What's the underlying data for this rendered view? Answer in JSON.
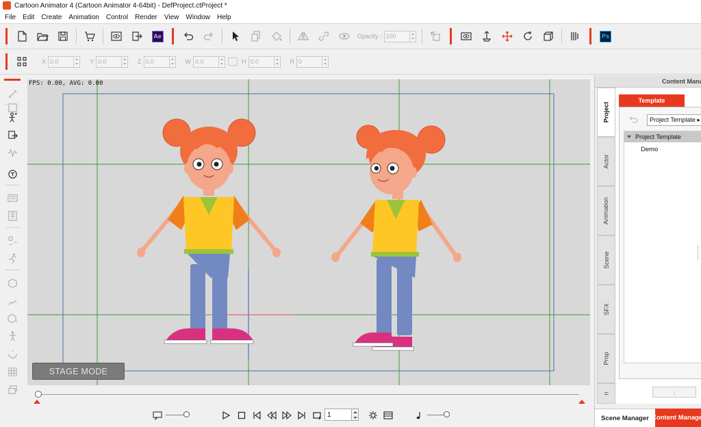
{
  "window": {
    "title": "Cartoon Animator 4  (Cartoon Animator 4-64bit) - DefProject.ctProject *"
  },
  "menu": [
    "File",
    "Edit",
    "Create",
    "Animation",
    "Control",
    "Render",
    "View",
    "Window",
    "Help"
  ],
  "toolbar": {
    "ae_label": "Ae",
    "ps_label": "Ps",
    "opacity_label": "Opacity :",
    "opacity_value": "100"
  },
  "transform": {
    "x_label": "X",
    "x_value": "0.0",
    "y_label": "Y",
    "y_value": "0.0",
    "z_label": "Z",
    "z_value": "0.0",
    "w_label": "W",
    "w_value": "0.0",
    "h_label": "H",
    "h_value": "0.0",
    "r_label": "R",
    "r_value": "0"
  },
  "stage": {
    "fps_text": "FPS: 0.00, AVG: 0.00",
    "mode_label": "STAGE MODE"
  },
  "playback": {
    "frame_value": "1"
  },
  "panel": {
    "header": "Content Manager",
    "vertical_tabs": [
      "Project",
      "Actor",
      "Animation",
      "Scene",
      "SFX",
      "Prop",
      "n"
    ],
    "active_tab": "Template",
    "dropdown_value": "Project Template ▸",
    "tree_root": "Project Template",
    "tree_child": "Demo",
    "down_arrow": "↓",
    "bottom_tabs": {
      "scene_manager": "Scene Manager",
      "content_manager": "Content Manager"
    }
  },
  "colors": {
    "accent": "#e8391e",
    "stage_bg": "#d8d8d8",
    "guide_green": "#3b9a3b",
    "frame_blue": "#4a6fa5"
  }
}
